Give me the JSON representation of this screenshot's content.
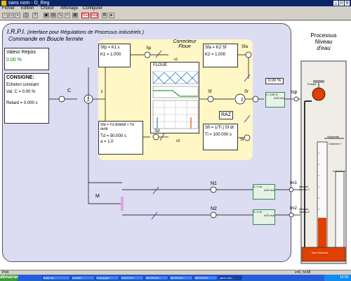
{
  "window": {
    "title": "sans nom - D_Reg"
  },
  "menu": [
    "Fichier",
    "Edition",
    "Choisir",
    "Affichage",
    "Configurer"
  ],
  "toolbar": {
    "start_label": "Start",
    "stop_label": "stop"
  },
  "header": {
    "title": "I.R.P.I.",
    "subtitle": "(interface pour Régulations de Processus industriels )",
    "mode": "Commande en Boucle fermée"
  },
  "left_panel": {
    "repos_label": "Valeur Repos",
    "repos_value": "0.00 %",
    "consigne_label": "CONSIGNE:",
    "echelon": "Echelon constant",
    "val_c": "Val. C = 0.00 %",
    "retard": "Retard = 0.000 s"
  },
  "pid": {
    "sp_eq": "Sfp = K1 ε",
    "k1": "K1 = 1.000",
    "sd_eq": "Sfd = Td dSfd/dt + Td dε/dt",
    "td": "Td = 50.000 s",
    "a": "a = 1.0",
    "sfa_eq": "Sfa = K2 Sf",
    "k2": "K2 = 1.000",
    "sfi_eq": "Sfi = 1/Ti ∫ Sf dt",
    "ti": "Ti = 100.000 s",
    "raz": "RAZ"
  },
  "fuzzy": {
    "title": "Correcteur Floue",
    "label": "FLOUE"
  },
  "signals": {
    "c": "C",
    "eps": "ε",
    "sp": "Sp",
    "sd": "Sd",
    "s1": "s1",
    "s2": "s2",
    "sfa": "Sfa",
    "sf": "Sf",
    "sr": "Sr",
    "si": "Si",
    "m": "M",
    "n1": "N1",
    "n2": "N2",
    "isp": "Isp",
    "im1": "Im1",
    "im2": "Im2",
    "out_pct": "0.00 %",
    "conv1_a": "0 / 100 %",
    "conv1_b": "4/20 mA",
    "meas1_a": "0 / 4 m",
    "meas1_b": "4/20 mA",
    "meas2_a": "0 / 4 m",
    "meas2_b": "4/20 mA"
  },
  "process": {
    "title1": "Processus",
    "title2": "Niveau",
    "title3": "d'eau",
    "pompe": "Pompe",
    "serpentin": "Serpentin",
    "colonne1": "Colonne 1",
    "colonne2": "Colonne 2",
    "mesure1": "Mesure niveau 1",
    "mesure2": "Mesure niveau 2",
    "bac": "Bac réservoir"
  },
  "status": {
    "left": "Prêt",
    "right": "x=0, h=28"
  },
  "taskbar": {
    "start": "démarrer",
    "tasks": [
      "boite de...",
      "corral2...",
      "Eac2pgM...",
      "PAGCOP...",
      "MICRO20...",
      "MICRO20...",
      "MICRO20...",
      "sans nom..."
    ],
    "clock": "15:55"
  },
  "colors": {
    "panel": "#dcdcf2",
    "fuzzy_bg": "#fff7c6",
    "tank_fill": "#e04000",
    "pump": "#e04000",
    "converter": "#2e8b57"
  }
}
